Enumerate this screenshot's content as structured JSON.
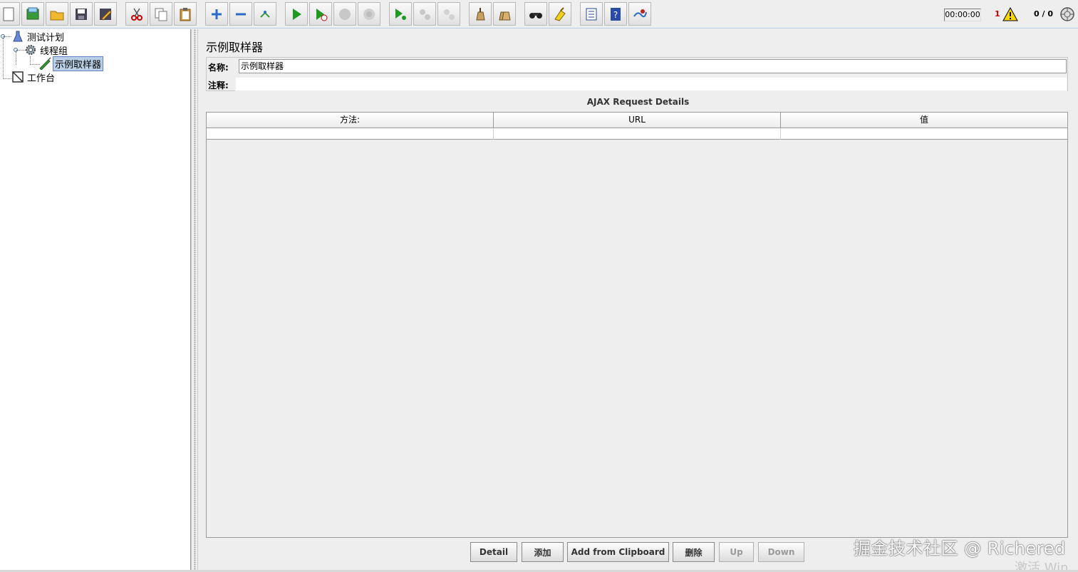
{
  "toolbar": {
    "buttons": [
      {
        "name": "new-icon"
      },
      {
        "name": "templates-icon"
      },
      {
        "name": "open-icon"
      },
      {
        "name": "save-icon"
      },
      {
        "name": "save-as-icon"
      },
      {
        "name": "cut-icon"
      },
      {
        "name": "copy-icon"
      },
      {
        "name": "paste-icon"
      },
      {
        "name": "expand-icon"
      },
      {
        "name": "collapse-icon"
      },
      {
        "name": "toggle-icon"
      },
      {
        "name": "start-icon"
      },
      {
        "name": "start-no-pause-icon"
      },
      {
        "name": "stop-icon"
      },
      {
        "name": "shutdown-icon"
      },
      {
        "name": "remote-start-icon"
      },
      {
        "name": "remote-stop-icon"
      },
      {
        "name": "remote-shutdown-icon"
      },
      {
        "name": "clear-icon"
      },
      {
        "name": "clear-all-icon"
      },
      {
        "name": "search-icon"
      },
      {
        "name": "reset-search-icon"
      },
      {
        "name": "function-helper-icon"
      },
      {
        "name": "help-icon"
      },
      {
        "name": "logger-icon"
      }
    ],
    "timer": "00:00:00",
    "error_count": "1",
    "thread_count": "0 / 0"
  },
  "tree": {
    "test_plan": "测试计划",
    "thread_group": "线程组",
    "sampler": "示例取样器",
    "workbench": "工作台"
  },
  "editor": {
    "title": "示例取样器",
    "name_label": "名称:",
    "name_value": "示例取样器",
    "comment_label": "注释:",
    "comment_value": "",
    "section_title": "AJAX Request Details",
    "columns": [
      "方法:",
      "URL",
      "值"
    ],
    "buttons": {
      "detail": "Detail",
      "add": "添加",
      "add_clipboard": "Add from Clipboard",
      "delete": "删除",
      "up": "Up",
      "down": "Down"
    }
  },
  "watermark": "掘金技术社区 @ Richered",
  "activate_text": "激活 Win"
}
